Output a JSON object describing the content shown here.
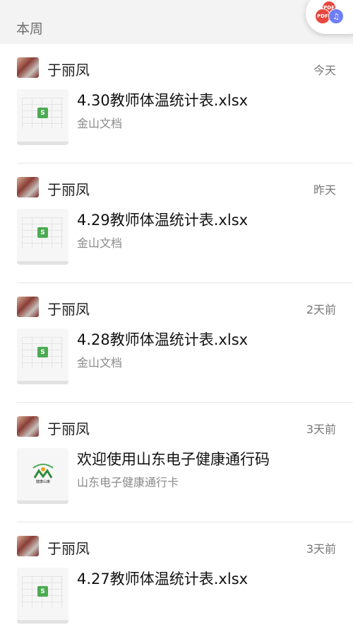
{
  "section": {
    "title": "本周"
  },
  "floating_action": {
    "pdf_top": "PDF",
    "pdf_bottom": "PDF",
    "music_icon": "music-icon"
  },
  "messages": [
    {
      "sender": "于丽凤",
      "time": "今天",
      "file_title": "4.30教师体温统计表.xlsx",
      "source": "金山文档",
      "thumb_label": "S"
    },
    {
      "sender": "于丽凤",
      "time": "昨天",
      "file_title": "4.29教师体温统计表.xlsx",
      "source": "金山文档",
      "thumb_label": "S"
    },
    {
      "sender": "于丽凤",
      "time": "2天前",
      "file_title": "4.28教师体温统计表.xlsx",
      "source": "金山文档",
      "thumb_label": "S"
    },
    {
      "sender": "于丽凤",
      "time": "3天前",
      "file_title": "欢迎使用山东电子健康通行码",
      "source": "山东电子健康通行卡",
      "thumb_label": "健康山东"
    },
    {
      "sender": "于丽凤",
      "time": "3天前",
      "file_title": "4.27教师体温统计表.xlsx",
      "source": "",
      "thumb_label": "S"
    }
  ],
  "colors": {
    "header_bg": "#f3f3f3",
    "xls_green": "#4bab52",
    "pdf_red": "#e7473f",
    "music_blue": "#6e7ff5"
  }
}
